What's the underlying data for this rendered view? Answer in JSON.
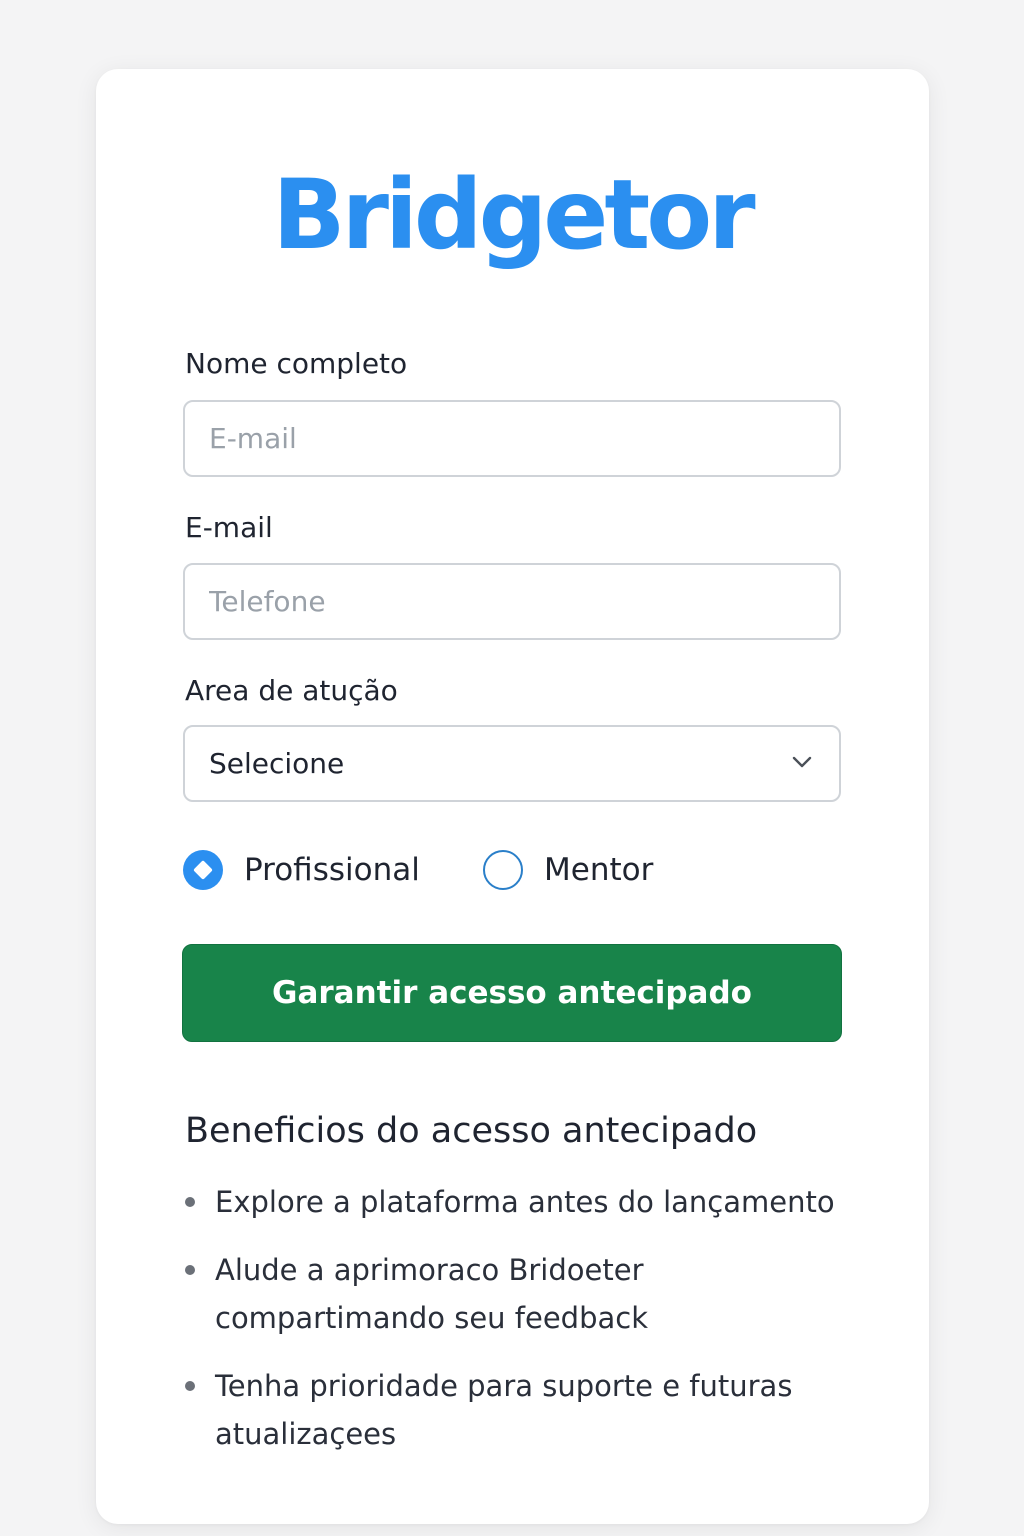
{
  "brand": {
    "name": "Bridgetor",
    "color": "#2b8ff0"
  },
  "form": {
    "name_label": "Nome completo",
    "name_placeholder": "E-mail",
    "email_label": "E-mail",
    "email_placeholder": "Telefone",
    "area_label": "Area de atução",
    "area_select_value": "Selecione",
    "role_options": [
      {
        "label": "Profissional",
        "selected": true
      },
      {
        "label": "Mentor",
        "selected": false
      }
    ],
    "submit_label": "Garantir acesso antecipado",
    "submit_color": "#18844a"
  },
  "benefits": {
    "title": "Beneficios do acesso antecipado",
    "items": [
      "Explore a plataforma antes do lançamento",
      "Alude a aprimoraco Bridoeter compartimando seu feedback",
      "Tenha prioridade para suporte e futuras atualizaçees"
    ]
  }
}
